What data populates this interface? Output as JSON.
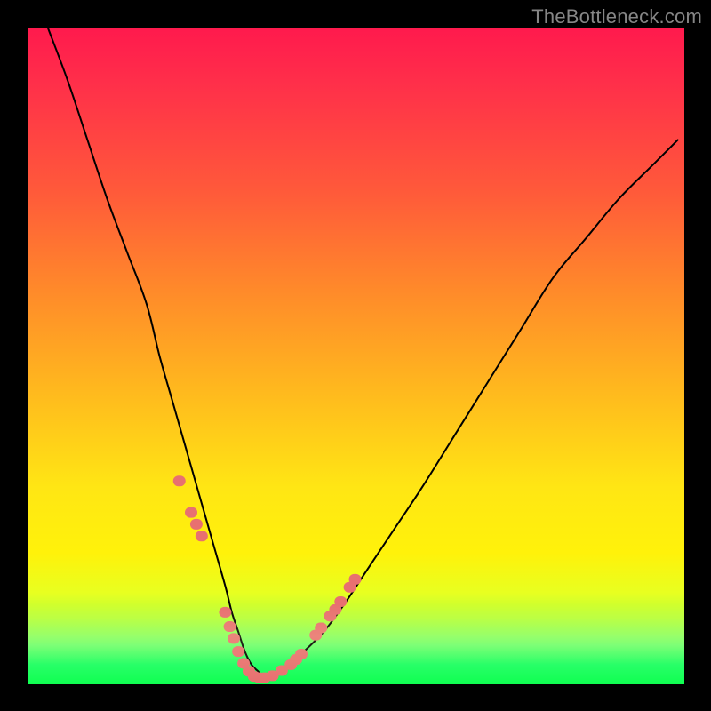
{
  "watermark": "TheBottleneck.com",
  "chart_data": {
    "type": "line",
    "title": "",
    "xlabel": "",
    "ylabel": "",
    "xlim": [
      0,
      100
    ],
    "ylim": [
      0,
      100
    ],
    "grid": false,
    "legend": false,
    "series": [
      {
        "name": "bottleneck-curve",
        "color": "#000000",
        "x": [
          3,
          6,
          9,
          12,
          15,
          18,
          20,
          22,
          24,
          26,
          28,
          30,
          31,
          32,
          33,
          34,
          35,
          36,
          38,
          40,
          42,
          45,
          48,
          52,
          56,
          60,
          65,
          70,
          75,
          80,
          85,
          90,
          95,
          99
        ],
        "values": [
          100,
          92,
          83,
          74,
          66,
          58,
          50,
          43,
          36,
          29,
          22,
          15,
          11,
          8,
          5,
          3,
          2,
          1,
          2,
          3,
          5,
          8,
          12,
          18,
          24,
          30,
          38,
          46,
          54,
          62,
          68,
          74,
          79,
          83
        ]
      },
      {
        "name": "highlight-dots",
        "color": "#e87070",
        "type": "scatter",
        "x": [
          23.0,
          24.8,
          25.6,
          26.4,
          30.0,
          30.7,
          31.3,
          32.0,
          32.8,
          33.6,
          34.4,
          35.2,
          36.0,
          37.2,
          38.6,
          40.0,
          40.8,
          41.6,
          43.8,
          44.6,
          46.0,
          46.8,
          47.6,
          49.0,
          49.8
        ],
        "values": [
          31.0,
          26.2,
          24.4,
          22.6,
          11.0,
          8.8,
          7.0,
          5.0,
          3.2,
          2.0,
          1.2,
          1.0,
          1.0,
          1.3,
          2.1,
          3.0,
          3.8,
          4.6,
          7.5,
          8.6,
          10.4,
          11.4,
          12.6,
          14.8,
          16.0
        ]
      }
    ]
  }
}
